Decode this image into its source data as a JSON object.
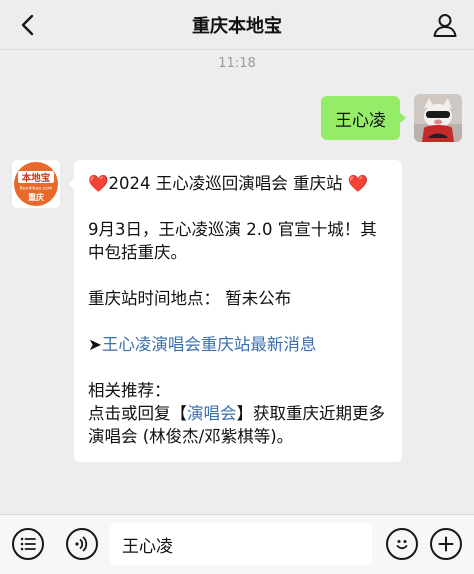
{
  "header": {
    "title": "重庆本地宝",
    "back_icon": "chevron-left-icon",
    "profile_icon": "person-icon"
  },
  "chat": {
    "timestamp": "11:18",
    "sent_message": "王心凌",
    "bot_avatar": {
      "logo_top": "本地宝",
      "logo_url": "Bendibao.com",
      "logo_city": "重庆"
    },
    "reply": {
      "heart": "❤️",
      "title": "2024 王心凌巡回演唱会 重庆站",
      "para1": "9月3日，王心凌巡演 2.0 官宣十城！其中包括重庆。",
      "para2": "重庆站时间地点： 暂未公布",
      "link_arrow": "➤",
      "link_text": "王心凌演唱会重庆站最新消息",
      "rec_label": "相关推荐：",
      "rec_prefix": "点击或回复【",
      "rec_keyword": "演唱会",
      "rec_suffix": "】获取重庆近期更多演唱会 (林俊杰/邓紫棋等)。"
    }
  },
  "input_bar": {
    "menu_icon": "list-menu-icon",
    "voice_icon": "voice-icon",
    "input_value": "王心凌",
    "emoji_icon": "emoji-icon",
    "plus_icon": "plus-icon"
  },
  "colors": {
    "background": "#ededed",
    "sent_bubble": "#95ec69",
    "link": "#3a6fb0",
    "logo_orange": "#e8692a"
  }
}
